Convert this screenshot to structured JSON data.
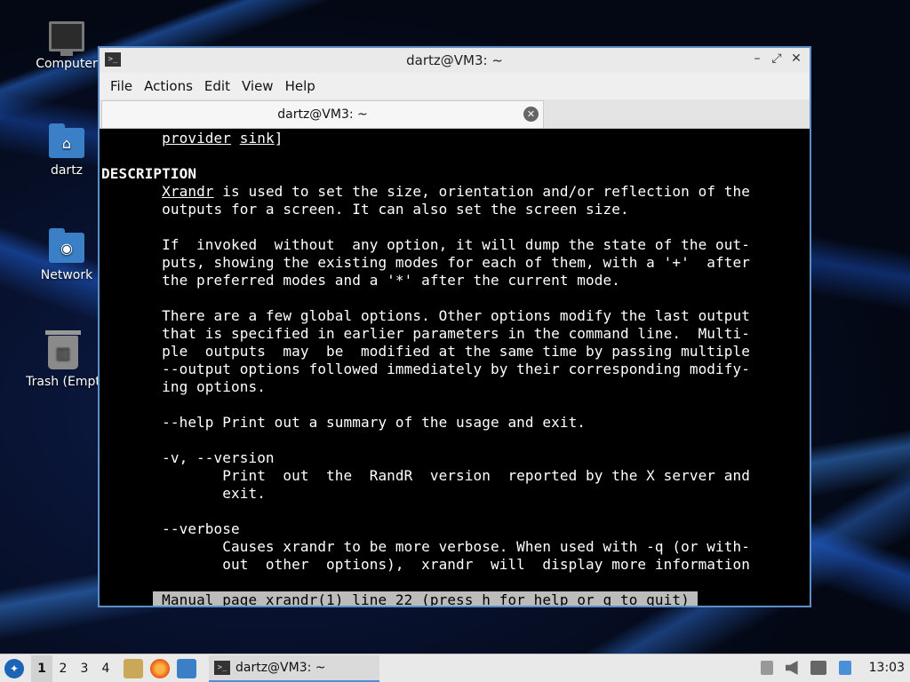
{
  "desktop": {
    "icons": [
      {
        "label": "Computer"
      },
      {
        "label": "dartz"
      },
      {
        "label": "Network"
      },
      {
        "label": "Trash (Empt"
      }
    ]
  },
  "window": {
    "title": "dartz@VM3: ~",
    "menu": [
      "File",
      "Actions",
      "Edit",
      "View",
      "Help"
    ],
    "tab_title": "dartz@VM3: ~",
    "terminal": {
      "lines": [
        "       provider sink]",
        "",
        "DESCRIPTION",
        "       Xrandr is used to set the size, orientation and/or reflection of the",
        "       outputs for a screen. It can also set the screen size.",
        "",
        "       If  invoked  without  any option, it will dump the state of the out-",
        "       puts, showing the existing modes for each of them, with a '+'  after",
        "       the preferred modes and a '*' after the current mode.",
        "",
        "       There are a few global options. Other options modify the last output",
        "       that is specified in earlier parameters in the command line.  Multi-",
        "       ple  outputs  may  be  modified at the same time by passing multiple",
        "       --output options followed immediately by their corresponding modify-",
        "       ing options.",
        "",
        "       --help Print out a summary of the usage and exit.",
        "",
        "       -v, --version",
        "              Print  out  the  RandR  version  reported by the X server and",
        "              exit.",
        "",
        "       --verbose",
        "              Causes xrandr to be more verbose. When used with -q (or with-",
        "              out  other  options),  xrandr  will  display more information"
      ],
      "status": " Manual page xrandr(1) line 22 (press h for help or q to quit)"
    }
  },
  "taskbar": {
    "workspaces": [
      "1",
      "2",
      "3",
      "4"
    ],
    "task_label": "dartz@VM3: ~",
    "clock": "13:03"
  }
}
